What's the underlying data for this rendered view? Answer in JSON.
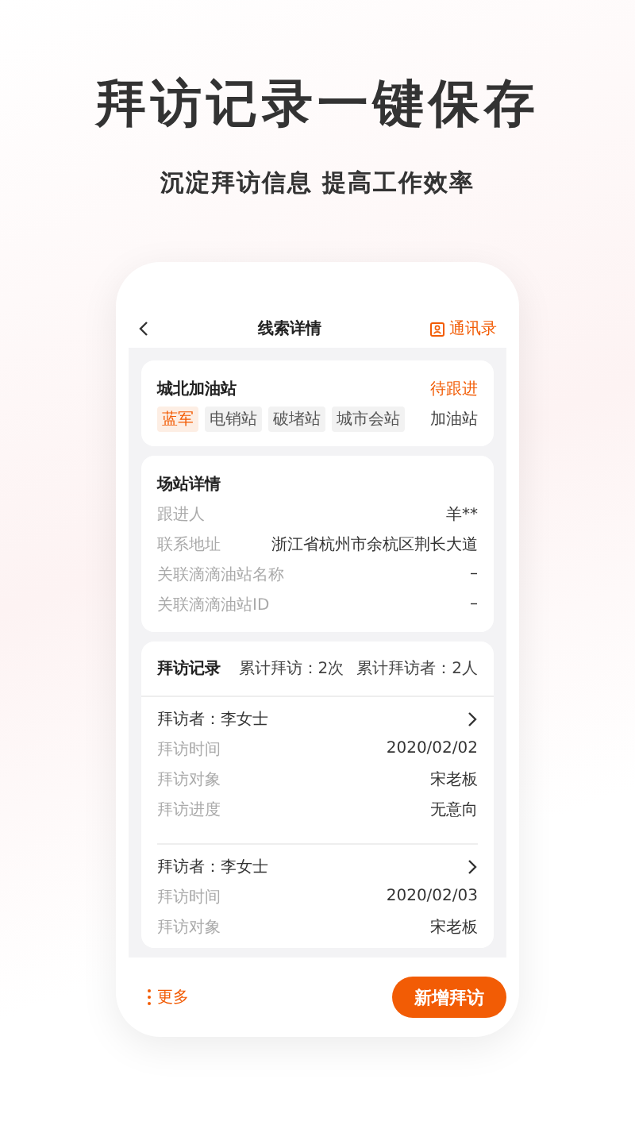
{
  "headline": "拜访记录一键保存",
  "subheadline": "沉淀拜访信息 提高工作效率",
  "nav": {
    "title": "线索详情",
    "action": "通讯录"
  },
  "station": {
    "name": "城北加油站",
    "status": "待跟进",
    "type": "加油站",
    "tags": [
      {
        "label": "蓝军",
        "highlighted": true
      },
      {
        "label": "电销站",
        "highlighted": false
      },
      {
        "label": "破堵站",
        "highlighted": false
      },
      {
        "label": "城市会站",
        "highlighted": false
      }
    ]
  },
  "details": {
    "title": "场站详情",
    "rows": [
      {
        "label": "跟进人",
        "value": "羊**"
      },
      {
        "label": "联系地址",
        "value": "浙江省杭州市余杭区荆长大道"
      },
      {
        "label": "关联滴滴油站名称",
        "value": "–"
      },
      {
        "label": "关联滴滴油站ID",
        "value": "–"
      }
    ]
  },
  "visits": {
    "title": "拜访记录",
    "total_visits": "累计拜访：2次",
    "total_visitors": "累计拜访者：2人",
    "records": [
      {
        "visitor": "拜访者：李女士",
        "rows": [
          {
            "label": "拜访时间",
            "value": "2020/02/02"
          },
          {
            "label": "拜访对象",
            "value": "宋老板"
          },
          {
            "label": "拜访进度",
            "value": "无意向"
          }
        ]
      },
      {
        "visitor": "拜访者：李女士",
        "rows": [
          {
            "label": "拜访时间",
            "value": "2020/02/03"
          },
          {
            "label": "拜访对象",
            "value": "宋老板"
          }
        ]
      }
    ]
  },
  "bottom": {
    "more": "更多",
    "add_button": "新增拜访"
  }
}
